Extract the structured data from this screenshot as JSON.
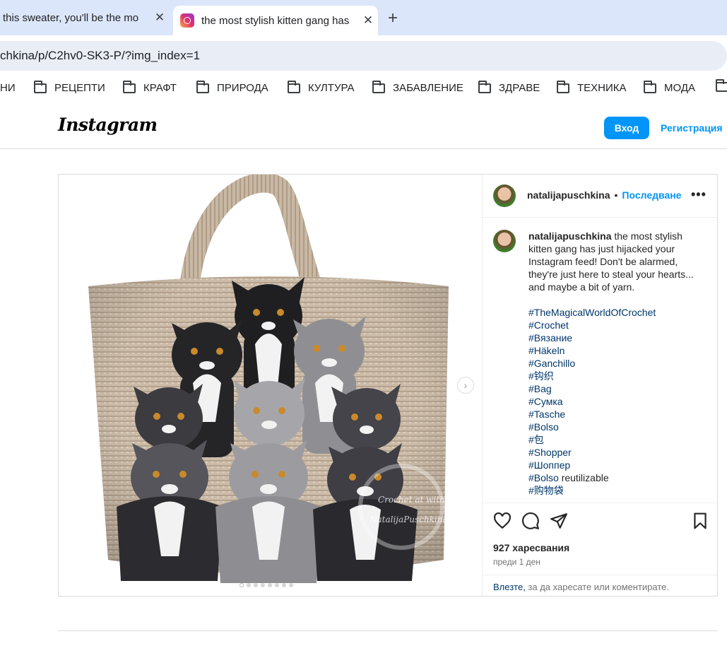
{
  "browser": {
    "tabs": [
      {
        "title": "this sweater, you'll be the mo",
        "active": false
      },
      {
        "title": "the most stylish kitten gang has",
        "active": true
      }
    ],
    "tab_close_glyph": "✕",
    "new_tab_glyph": "+",
    "url": "chkina/p/C2hv0-SK3-P/?img_index=1",
    "bookmarks": [
      "НИ",
      "РЕЦЕПТИ",
      "КРАФТ",
      "ПРИРОДА",
      "КУЛТУРА",
      "ЗАБАВЛЕНИЕ",
      "ЗДРАВЕ",
      "ТЕХНИКА",
      "МОДА",
      ""
    ]
  },
  "header": {
    "logo": "Instagram",
    "login_button": "Вход",
    "signup_link": "Регистрация"
  },
  "post": {
    "username": "natalijapuschkina",
    "follow_label": "Последване",
    "more_glyph": "•••",
    "caption_text": "the most stylish kitten gang has just hijacked your Instagram feed! Don't be alarmed, they're just here to steal your hearts... and maybe a bit of yarn.",
    "hashtags": [
      "#TheMagicalWorldOfCrochet",
      "#Crochet",
      "#Вязание",
      "#Häkeln",
      "#Ganchillo",
      "#钩织",
      "#Bag",
      "#Сумка",
      "#Tasche",
      "#Bolso"
    ],
    "hashtag_china_bag": "#包",
    "hashtag_shopper": "#Shopper",
    "hashtag_shopper_ru": "#Шоппер",
    "hashtag_bolso2": "#Bolso",
    "bolso2_suffix": " reutilizable",
    "hashtag_last": "#购物袋",
    "likes": "927 харесвания",
    "date": "преди 1 ден",
    "login_word": "Влезте,",
    "comment_prompt": " за да харесате или коментирате.",
    "watermark_line1": "Crochet at with",
    "watermark_line2": "NatalijaPuschkina",
    "carousel_total": 8,
    "carousel_index": 1
  },
  "colors": {
    "accent": "#0095f6",
    "tabbar": "#dce6fa",
    "hashtag": "#00376b"
  }
}
